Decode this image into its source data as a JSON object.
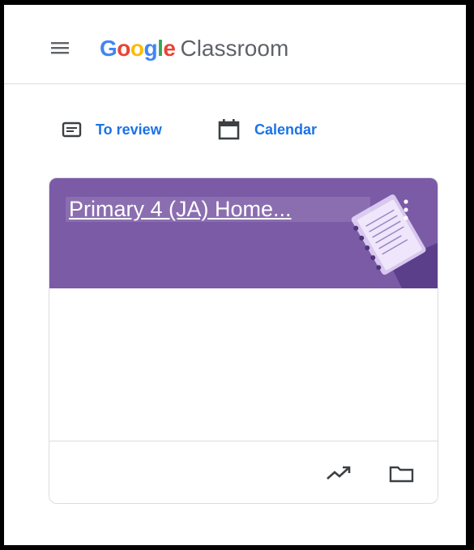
{
  "header": {
    "menu_icon": "hamburger-menu-icon",
    "logo_word": "Google",
    "logo_letters": [
      {
        "char": "G",
        "color": "#4285F4"
      },
      {
        "char": "o",
        "color": "#EA4335"
      },
      {
        "char": "o",
        "color": "#FBBC05"
      },
      {
        "char": "g",
        "color": "#4285F4"
      },
      {
        "char": "l",
        "color": "#34A853"
      },
      {
        "char": "e",
        "color": "#EA4335"
      }
    ],
    "product_name": "Classroom"
  },
  "toolbar": {
    "to_review_label": "To review",
    "to_review_icon": "assignment-list-icon",
    "calendar_label": "Calendar",
    "calendar_icon": "calendar-icon"
  },
  "card": {
    "title": "Primary 4 (JA) Home...",
    "banner_color": "#7b5aa6",
    "more_icon": "more-vert-icon",
    "footer_icons": [
      "trending-up-icon",
      "folder-icon"
    ]
  },
  "colors": {
    "accent": "#1a73e8",
    "divider": "#dadce0"
  }
}
